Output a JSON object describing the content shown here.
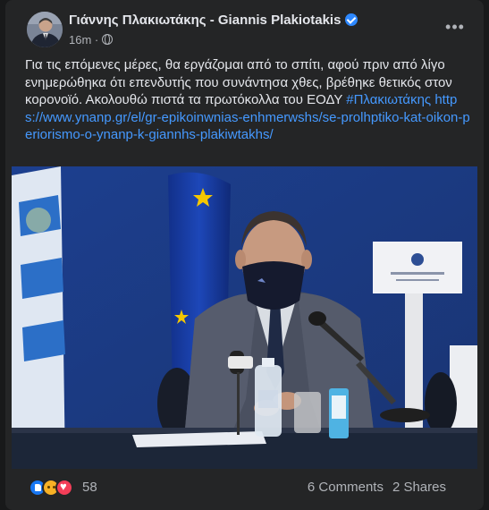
{
  "post": {
    "author": "Γιάννης Πλακιωτάκης - Giannis Plakiotakis",
    "time": "16m",
    "separator": "·",
    "text": "Για τις επόμενες μέρες, θα εργάζομαι από το σπίτι, αφού πριν από λίγο ενημερώθηκα ότι επενδυτής που συνάντησα χθες, βρέθηκε θετικός στον κορονοϊό. Ακολουθώ πιστά τα πρωτόκολλα του ΕΟΔΥ",
    "hashtag": "#Πλακιωτάκης",
    "link": "https://www.ynanp.gr/el/gr-epikoinwnias-enhmerwshs/se-prolhptiko-kat-oikon-periorismo-o-ynanp-k-giannhs-plakiwtakhs/",
    "photo_alt": "Man wearing a dark face mask speaking at a press conference desk with microphones, Greek and EU flags behind him",
    "reactions": {
      "types": [
        "like-icon",
        "care-icon",
        "love-icon"
      ],
      "count": "58"
    },
    "comments": "6 Comments",
    "shares": "2 Shares"
  },
  "colors": {
    "background": "#18191a",
    "card": "#242526",
    "text": "#e4e6eb",
    "muted": "#b0b3b8",
    "link": "#4599ff",
    "verified": "#2d88ff"
  }
}
